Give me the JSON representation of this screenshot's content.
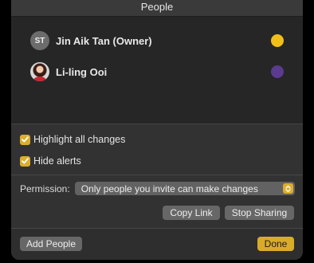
{
  "window": {
    "title": "People"
  },
  "participants": [
    {
      "initials": "ST",
      "name": "Jin Aik Tan (Owner)",
      "avatar": "initials-avatar",
      "color": "#f2bf19"
    },
    {
      "initials": "",
      "name": "Li-ling Ooi",
      "avatar": "photo-avatar",
      "color": "#5b3a91"
    }
  ],
  "options": {
    "highlight_label": "Highlight all changes",
    "highlight_checked": true,
    "hide_alerts_label": "Hide alerts",
    "hide_alerts_checked": true
  },
  "permission": {
    "label": "Permission:",
    "selected": "Only people you invite can make changes"
  },
  "buttons": {
    "copy_link": "Copy Link",
    "stop_sharing": "Stop Sharing",
    "add_people": "Add People",
    "done": "Done"
  },
  "colors": {
    "accent": "#d8ab2a",
    "panel": "#323232",
    "list": "#262626"
  }
}
